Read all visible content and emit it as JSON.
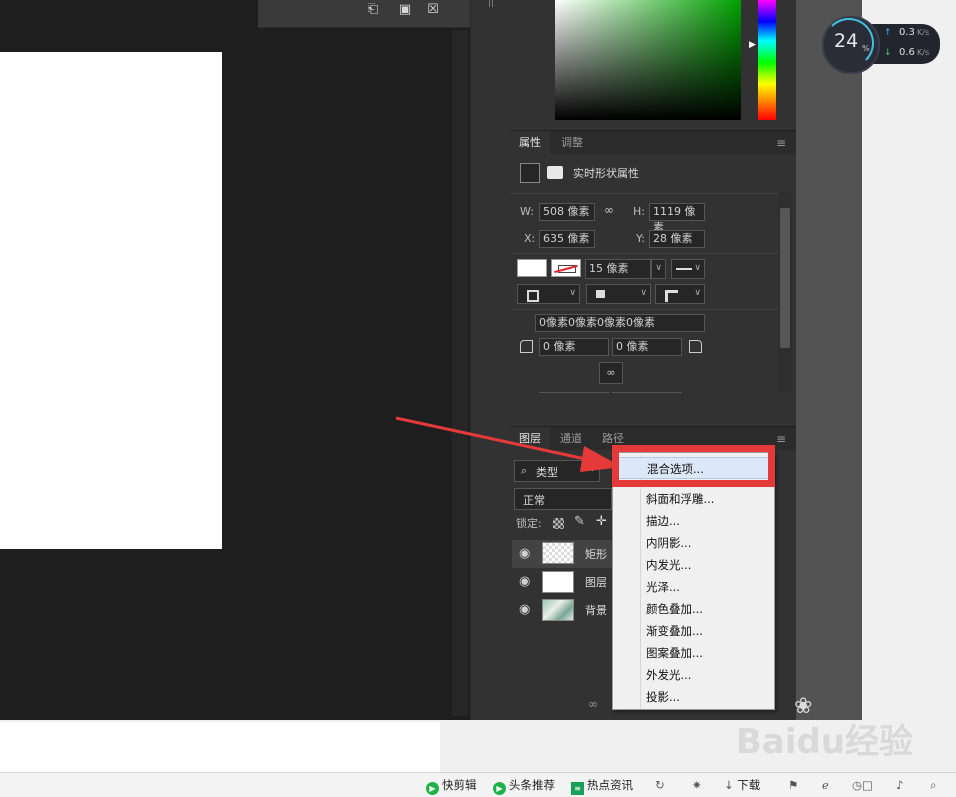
{
  "toolbar_icons": [
    "add-layer-icon",
    "camera-icon",
    "trash-icon"
  ],
  "properties": {
    "tabs": [
      {
        "label": "属性",
        "active": true
      },
      {
        "label": "调整",
        "active": false
      }
    ],
    "title": "实时形状属性",
    "w_label": "W:",
    "w_value": "508 像素",
    "h_label": "H:",
    "h_value": "1119 像素",
    "x_label": "X:",
    "x_value": "635 像素",
    "y_label": "Y:",
    "y_value": "28 像素",
    "stroke_width": "15 像素",
    "corner_all": "0像素0像素0像素0像素",
    "corner_tl": "0 像素",
    "corner_tr": "0 像素"
  },
  "layers": {
    "tabs": [
      {
        "label": "图层",
        "active": true
      },
      {
        "label": "通道",
        "active": false
      },
      {
        "label": "路径",
        "active": false
      }
    ],
    "filter_label": "类型",
    "blend_mode": "正常",
    "lock_label": "锁定:",
    "rows": [
      {
        "name": "矩形"
      },
      {
        "name": "图层"
      },
      {
        "name": "背景"
      }
    ]
  },
  "context_menu": {
    "items": [
      "混合选项...",
      "斜面和浮雕...",
      "描边...",
      "内阴影...",
      "内发光...",
      "光泽...",
      "颜色叠加...",
      "渐变叠加...",
      "图案叠加...",
      "外发光...",
      "投影..."
    ],
    "highlighted_index": 0
  },
  "net_widget": {
    "percent": "24",
    "percent_unit": "%",
    "up": "0.3",
    "down": "0.6",
    "unit": "K/s"
  },
  "watermark": "Baidu经验",
  "statusbar": {
    "items": [
      "快剪辑",
      "头条推荐",
      "热点资讯",
      "下载"
    ]
  },
  "colors": {
    "accent_red": "#e63a3a",
    "menu_highlight": "#dce8f8",
    "status_green": "#20b24a"
  }
}
